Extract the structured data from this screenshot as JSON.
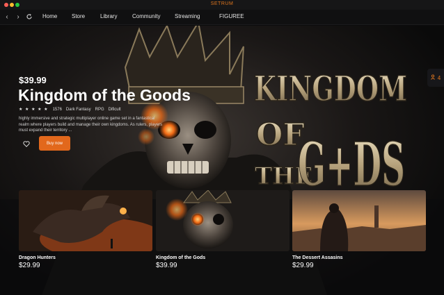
{
  "window": {
    "title": "SETRUM"
  },
  "nav": {
    "links": [
      "Home",
      "Store",
      "Library",
      "Community",
      "Streaming",
      "FIGUREE"
    ]
  },
  "side_tab": {
    "count": "4",
    "icon": "users-icon"
  },
  "hero": {
    "price": "$39.99",
    "title": "Kingdom of the Goods",
    "rating_stars": "★ ★ ★ ★ ★",
    "rating_count": "1576",
    "tags": [
      "Dark Fantasy",
      "RPG",
      "Dificult"
    ],
    "description": "highly immersive and strategic multiplayer online game set in a fantastical realm where players build and manage their own kingdoms. As rulers, players must expand their territory ...",
    "buy_label": "Buy now",
    "logo_line1": "KINGDOM",
    "logo_line2": "OF",
    "logo_line3": "THE",
    "logo_line4": "G+DS"
  },
  "cards": [
    {
      "title": "Dragon Hunters",
      "price": "$29.99"
    },
    {
      "title": "Kingdom of the Gods",
      "price": "$39.99"
    },
    {
      "title": "The Dessert Assasins",
      "price": "$29.99"
    }
  ],
  "colors": {
    "accent": "#e2681c",
    "background": "#0b0b0c"
  }
}
